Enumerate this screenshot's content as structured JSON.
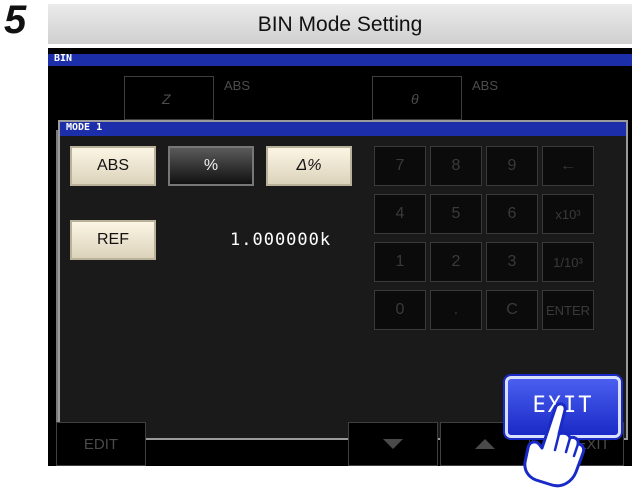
{
  "step_number": "5",
  "title": "BIN Mode Setting",
  "screen": {
    "bin_label": "BIN",
    "background_params": [
      {
        "symbol": "Z",
        "mode": "ABS"
      },
      {
        "symbol": "θ",
        "mode": "ABS"
      }
    ]
  },
  "dialog": {
    "title": "MODE 1",
    "mode_buttons": [
      {
        "label": "ABS",
        "selected": false
      },
      {
        "label": "%",
        "selected": true
      },
      {
        "label": "Δ%",
        "selected": false
      }
    ],
    "ref_button": "REF",
    "ref_value": "1.000000k",
    "keypad": [
      "7",
      "8",
      "9",
      "←",
      "4",
      "5",
      "6",
      "x10³",
      "1",
      "2",
      "3",
      "1/10³",
      "0",
      ".",
      "C",
      "ENTER"
    ],
    "exit_button": "EXIT"
  },
  "footer": {
    "edit": "EDIT",
    "down_icon": "triangle-down",
    "up_icon": "triangle-up",
    "exit": "EXIT"
  },
  "colors": {
    "title_blue": "#1c2eaa",
    "exit_highlight": "#2a3bd8",
    "button_light": "#f3ecd6"
  }
}
